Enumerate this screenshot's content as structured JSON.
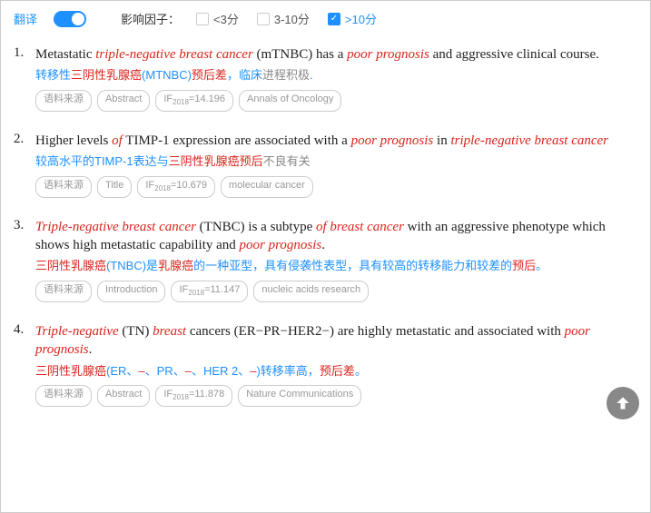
{
  "toolbar": {
    "translate_label": "翻译",
    "impact_label": "影响因子：",
    "filters": [
      {
        "label": "<3分",
        "checked": false
      },
      {
        "label": "3-10分",
        "checked": false
      },
      {
        "label": ">10分",
        "checked": true
      }
    ]
  },
  "tags": {
    "source": "语料来源",
    "abstract": "Abstract",
    "title": "Title",
    "introduction": "Introduction",
    "if_label": "IF",
    "if_year": "2018"
  },
  "items": [
    {
      "num": "1.",
      "eng_parts": [
        "Metastatic ",
        "triple-negative breast cancer",
        " (mTNBC) has a ",
        "poor prognosis",
        " and aggressive clinical course."
      ],
      "cn_blue1": "转移性",
      "cn_red1": "三阴性乳腺癌",
      "cn_blue2": "(MTNBC)",
      "cn_red2": "预后差",
      "cn_blue3": "，临床",
      "cn_gray": "进程积极",
      "cn_blue4": ".",
      "tag_section": "Abstract",
      "if_value": "=14.196",
      "journal": "Annals of Oncology"
    },
    {
      "num": "2.",
      "eng_parts": [
        "Higher levels ",
        "of",
        " TIMP-1 expression are associated with a ",
        "poor prognosis",
        " in ",
        "triple-negative breast cancer"
      ],
      "cn_blue1": "较高水平的TIMP-1表达与",
      "cn_red1": "三阴性乳腺癌预后",
      "cn_gray": "不良有关",
      "tag_section": "Title",
      "if_value": "=10.679",
      "journal": "molecular cancer"
    },
    {
      "num": "3.",
      "eng_parts": [
        "",
        "Triple-negative breast cancer",
        " (TNBC) is a subtype ",
        "of breast cancer",
        " with an aggressive phenotype which shows high metastatic capability and ",
        "poor prognosis",
        "."
      ],
      "cn_red1": "三阴性乳腺癌",
      "cn_blue1": "(TNBC)是",
      "cn_red2": "乳腺癌",
      "cn_blue2": "的一种亚型，具有侵袭性表型，具有较高的转移能力和较差的",
      "cn_red3": "预后",
      "cn_blue3": "。",
      "tag_section": "Introduction",
      "if_value": "=11.147",
      "journal": "nucleic acids research"
    },
    {
      "num": "4.",
      "eng_parts": [
        "",
        "Triple-negative",
        " (TN) ",
        "breast",
        " cancers (ER−PR−HER2−) are highly metastatic and associated with ",
        "poor prognosis",
        "."
      ],
      "cn_red1": "三阴性乳腺癌",
      "cn_blue1": "(ER、",
      "cn_red2": "–",
      "cn_blue2": "、PR、",
      "cn_red3": "–",
      "cn_blue3": "、HER 2、",
      "cn_red4": "–",
      "cn_blue4": ")转移率高，",
      "cn_red5": "预后差",
      "cn_blue5": "。",
      "tag_section": "Abstract",
      "if_value": "=11.878",
      "journal": "Nature Communications"
    }
  ]
}
